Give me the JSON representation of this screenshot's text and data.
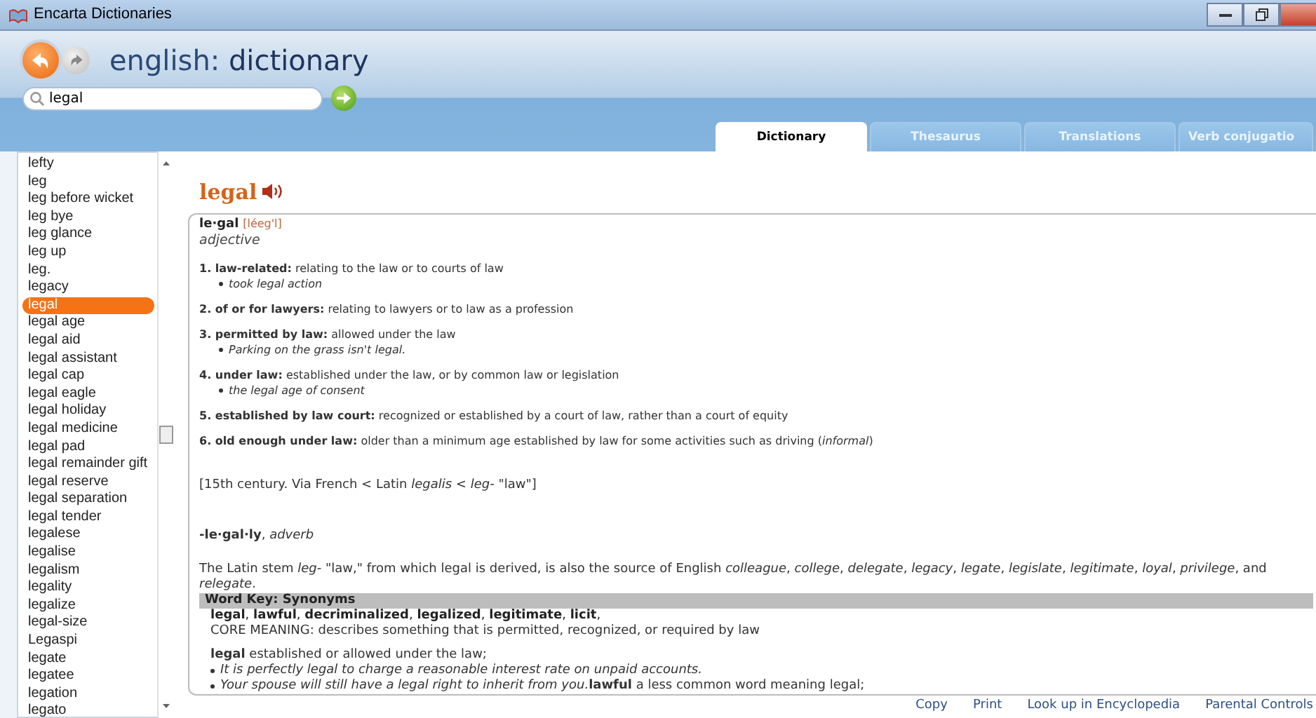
{
  "window": {
    "title": "Encarta Dictionaries"
  },
  "header": {
    "title_prefix": "english:",
    "title": "dictionary"
  },
  "search": {
    "value": "legal"
  },
  "tabs": [
    {
      "label": "Dictionary",
      "selected": true
    },
    {
      "label": "Thesaurus",
      "selected": false
    },
    {
      "label": "Translations",
      "selected": false
    },
    {
      "label": "Verb conjugatio",
      "selected": false
    }
  ],
  "word_list": [
    {
      "label": "lefty",
      "selected": false
    },
    {
      "label": "leg",
      "selected": false
    },
    {
      "label": "leg before wicket",
      "selected": false
    },
    {
      "label": "leg bye",
      "selected": false
    },
    {
      "label": "leg glance",
      "selected": false
    },
    {
      "label": "leg up",
      "selected": false
    },
    {
      "label": "leg.",
      "selected": false
    },
    {
      "label": "legacy",
      "selected": false
    },
    {
      "label": "legal",
      "selected": true
    },
    {
      "label": "legal age",
      "selected": false
    },
    {
      "label": "legal aid",
      "selected": false
    },
    {
      "label": "legal assistant",
      "selected": false
    },
    {
      "label": "legal cap",
      "selected": false
    },
    {
      "label": "legal eagle",
      "selected": false
    },
    {
      "label": "legal holiday",
      "selected": false
    },
    {
      "label": "legal medicine",
      "selected": false
    },
    {
      "label": "legal pad",
      "selected": false
    },
    {
      "label": "legal remainder gift",
      "selected": false
    },
    {
      "label": "legal reserve",
      "selected": false
    },
    {
      "label": "legal separation",
      "selected": false
    },
    {
      "label": "legal tender",
      "selected": false
    },
    {
      "label": "legalese",
      "selected": false
    },
    {
      "label": "legalise",
      "selected": false
    },
    {
      "label": "legalism",
      "selected": false
    },
    {
      "label": "legality",
      "selected": false
    },
    {
      "label": "legalize",
      "selected": false
    },
    {
      "label": "legal-size",
      "selected": false
    },
    {
      "label": "Legaspi",
      "selected": false
    },
    {
      "label": "legate",
      "selected": false
    },
    {
      "label": "legatee",
      "selected": false
    },
    {
      "label": "legation",
      "selected": false
    },
    {
      "label": "legato",
      "selected": false
    }
  ],
  "entry": {
    "headword": "legal",
    "syllables": "le·gal",
    "pronunciation": "[léeg'l]",
    "part_of_speech": "adjective",
    "senses": [
      {
        "number": "1.",
        "label": "law-related:",
        "definition": "relating to the law or to courts of law",
        "example": "took legal action"
      },
      {
        "number": "2.",
        "label": "of or for lawyers:",
        "definition": "relating to lawyers or to law as a profession"
      },
      {
        "number": "3.",
        "label": "permitted by law:",
        "definition": "allowed under the law",
        "example": "Parking on the grass isn't legal."
      },
      {
        "number": "4.",
        "label": "under law:",
        "definition": "established under the law, or by common law or legislation",
        "example": "the legal age of consent"
      },
      {
        "number": "5.",
        "label": "established by law court:",
        "definition": "recognized or established by a court of law, rather than a court of equity"
      },
      {
        "number": "6.",
        "label": "old enough under law:",
        "definition": "older than a minimum age established by law for some activities such as driving (*informal*)"
      }
    ],
    "etymology": "[15th century. Via French < Latin *legalis* < *leg-* \"law\"]",
    "derived": "**-le·gal·ly**, *adverb*",
    "note": "The Latin stem *leg-* \"law,\" from which legal is derived, is also the source of English *colleague*, *college*, *delegate*, *legacy*, *legate*, *legislate*, *legitimate*, *loyal*, *privilege*, and *relegate*.",
    "word_key": {
      "heading": "Word Key: Synonyms",
      "synonyms": "**legal**, **lawful**, **decriminalized**, **legalized**, **legitimate**, **licit**,",
      "core_meaning": "CORE MEANING: describes something that is permitted, recognized, or required by law",
      "usage": "**legal** established or allowed under the law;",
      "examples": [
        {
          "text": "It is perfectly legal to charge a reasonable interest rate on unpaid accounts."
        },
        {
          "text": "Your spouse will still have a legal right to inherit from you.",
          "tail": "**lawful** a less common word meaning legal;"
        }
      ]
    }
  },
  "footer_links": [
    "Copy",
    "Print",
    "Look up in Encyclopedia",
    "Parental Controls"
  ]
}
